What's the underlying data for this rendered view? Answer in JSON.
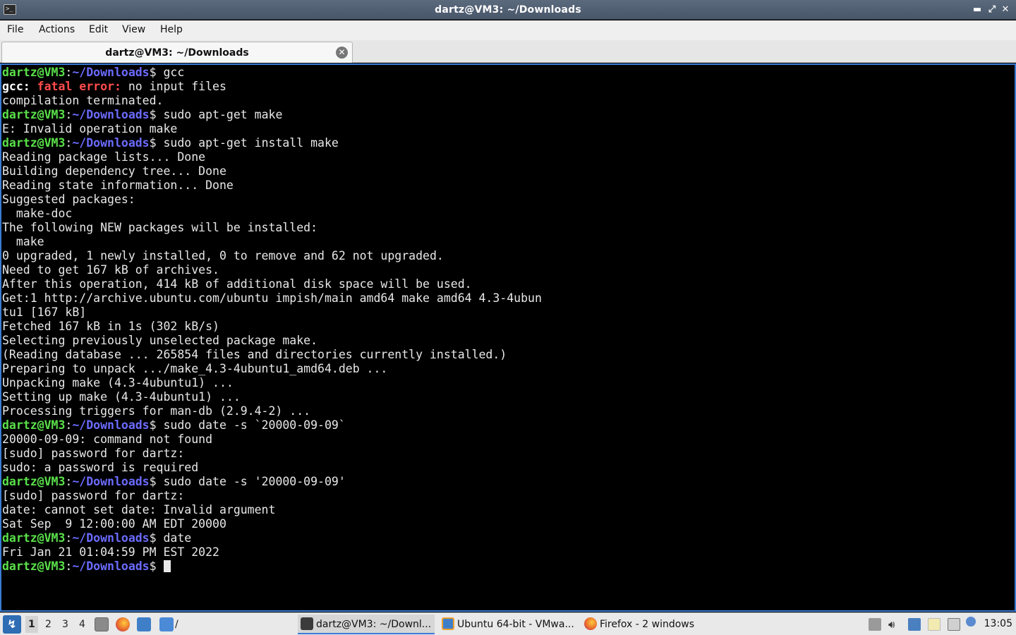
{
  "window": {
    "title": "dartz@VM3: ~/Downloads",
    "minimize": "▬",
    "maximize": "⤢",
    "close": "✕"
  },
  "menu": [
    "File",
    "Actions",
    "Edit",
    "View",
    "Help"
  ],
  "tab": {
    "label": "dartz@VM3: ~/Downloads",
    "close": "✕"
  },
  "prompt": {
    "user": "dartz@VM3",
    "colon": ":",
    "path": "~/Downloads",
    "dollar": "$"
  },
  "terminal_lines": [
    {
      "type": "prompt",
      "cmd": " gcc"
    },
    {
      "type": "gccerr",
      "a": "gcc:",
      "b": " fatal error:",
      "c": " no input files"
    },
    {
      "type": "text",
      "text": "compilation terminated."
    },
    {
      "type": "prompt",
      "cmd": " sudo apt-get make"
    },
    {
      "type": "text",
      "text": "E: Invalid operation make"
    },
    {
      "type": "prompt",
      "cmd": " sudo apt-get install make"
    },
    {
      "type": "text",
      "text": "Reading package lists... Done"
    },
    {
      "type": "text",
      "text": "Building dependency tree... Done"
    },
    {
      "type": "text",
      "text": "Reading state information... Done"
    },
    {
      "type": "text",
      "text": "Suggested packages:"
    },
    {
      "type": "text",
      "text": "  make-doc"
    },
    {
      "type": "text",
      "text": "The following NEW packages will be installed:"
    },
    {
      "type": "text",
      "text": "  make"
    },
    {
      "type": "text",
      "text": "0 upgraded, 1 newly installed, 0 to remove and 62 not upgraded."
    },
    {
      "type": "text",
      "text": "Need to get 167 kB of archives."
    },
    {
      "type": "text",
      "text": "After this operation, 414 kB of additional disk space will be used."
    },
    {
      "type": "text",
      "text": "Get:1 http://archive.ubuntu.com/ubuntu impish/main amd64 make amd64 4.3-4ubun"
    },
    {
      "type": "text",
      "text": "tu1 [167 kB]"
    },
    {
      "type": "text",
      "text": "Fetched 167 kB in 1s (302 kB/s)"
    },
    {
      "type": "text",
      "text": "Selecting previously unselected package make."
    },
    {
      "type": "text",
      "text": "(Reading database ... 265854 files and directories currently installed.)"
    },
    {
      "type": "text",
      "text": "Preparing to unpack .../make_4.3-4ubuntu1_amd64.deb ..."
    },
    {
      "type": "text",
      "text": "Unpacking make (4.3-4ubuntu1) ..."
    },
    {
      "type": "text",
      "text": "Setting up make (4.3-4ubuntu1) ..."
    },
    {
      "type": "text",
      "text": "Processing triggers for man-db (2.9.4-2) ..."
    },
    {
      "type": "prompt",
      "cmd": " sudo date -s `20000-09-09`"
    },
    {
      "type": "text",
      "text": "20000-09-09: command not found"
    },
    {
      "type": "text",
      "text": "[sudo] password for dartz:"
    },
    {
      "type": "text",
      "text": "sudo: a password is required"
    },
    {
      "type": "prompt",
      "cmd": " sudo date -s '20000-09-09'"
    },
    {
      "type": "text",
      "text": "[sudo] password for dartz:"
    },
    {
      "type": "text",
      "text": "date: cannot set date: Invalid argument"
    },
    {
      "type": "text",
      "text": "Sat Sep  9 12:00:00 AM EDT 20000"
    },
    {
      "type": "prompt",
      "cmd": " date"
    },
    {
      "type": "text",
      "text": "Fri Jan 21 01:04:59 PM EST 2022"
    },
    {
      "type": "prompt",
      "cmd": " ",
      "cursor": true
    }
  ],
  "taskbar": {
    "workspaces": [
      "1",
      "2",
      "3",
      "4"
    ],
    "folder_label": "/",
    "tasks": [
      {
        "label": "dartz@VM3: ~/Downl...",
        "icon_color": "#3b3b3b"
      },
      {
        "label": "Ubuntu 64-bit - VMwa...",
        "icon_color": "#3f7fc8"
      },
      {
        "label": "Firefox - 2 windows",
        "icon_color": "#e8632b"
      }
    ],
    "clock": "13:05"
  }
}
